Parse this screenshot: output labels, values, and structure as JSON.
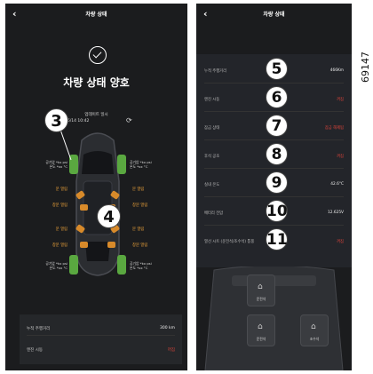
{
  "screens": {
    "left": {
      "header": {
        "back_icon": "‹",
        "title": "차량 상태"
      },
      "status_title": "차량 상태 양호",
      "update_label": "업데이트 일시",
      "update_time": "2024/06/14 10:42",
      "tires": {
        "front_left": [
          "공기압 *kx psi",
          "온도 *xx °C"
        ],
        "front_right": [
          "공기압 *kx psi",
          "온도 *xx °C"
        ],
        "rear_left": [
          "공기압 *kx psi",
          "온도 *xx °C"
        ],
        "rear_right": [
          "공기압 *kx psi",
          "온도 *xx °C"
        ]
      },
      "door_labels": {
        "left": [
          "문 열림",
          "창문 열림",
          "문 열림",
          "창문 열림"
        ],
        "right": [
          "문 열림",
          "창문 열림",
          "문 열림",
          "창문 열림"
        ]
      },
      "callouts": [
        "3",
        "4"
      ],
      "rows": [
        {
          "key": "누적 주행거리",
          "value": "300 km",
          "alert": false
        },
        {
          "key": "엔진 시동",
          "value": "꺼짐",
          "alert": true
        }
      ]
    },
    "right": {
      "header": {
        "back_icon": "‹",
        "title": "차량 상태"
      },
      "rows": [
        {
          "key": "누적 주행거리",
          "value": "466Km",
          "callout": "5",
          "alert": false
        },
        {
          "key": "엔진 시동",
          "value": "꺼짐",
          "callout": "6",
          "alert": true
        },
        {
          "key": "잠금 상태",
          "value": "잠금 해제됨",
          "callout": "7",
          "alert": true
        },
        {
          "key": "후석 공조",
          "value": "꺼짐",
          "callout": "8",
          "alert": true
        },
        {
          "key": "실내 온도",
          "value": "42.6°C",
          "callout": "9",
          "alert": false
        },
        {
          "key": "배터리 전압",
          "value": "12.625V",
          "callout": "10",
          "alert": false
        },
        {
          "key": "열선 시트 (운전석/조수석) 통풍",
          "value": "꺼짐",
          "callout": "11",
          "alert": true
        }
      ],
      "seat_buttons": [
        {
          "label": "운전석",
          "icon": "seat-icon"
        },
        {
          "label": "운전석",
          "icon": "seat-icon"
        },
        {
          "label": "조수석",
          "icon": "seat-icon"
        }
      ]
    }
  },
  "figure_id": "69147",
  "colors": {
    "screen_bg": "#1b1c1e",
    "tire_ok": "#5aa840",
    "door_open": "#d88a2a",
    "alert_text": "#e0443a"
  }
}
